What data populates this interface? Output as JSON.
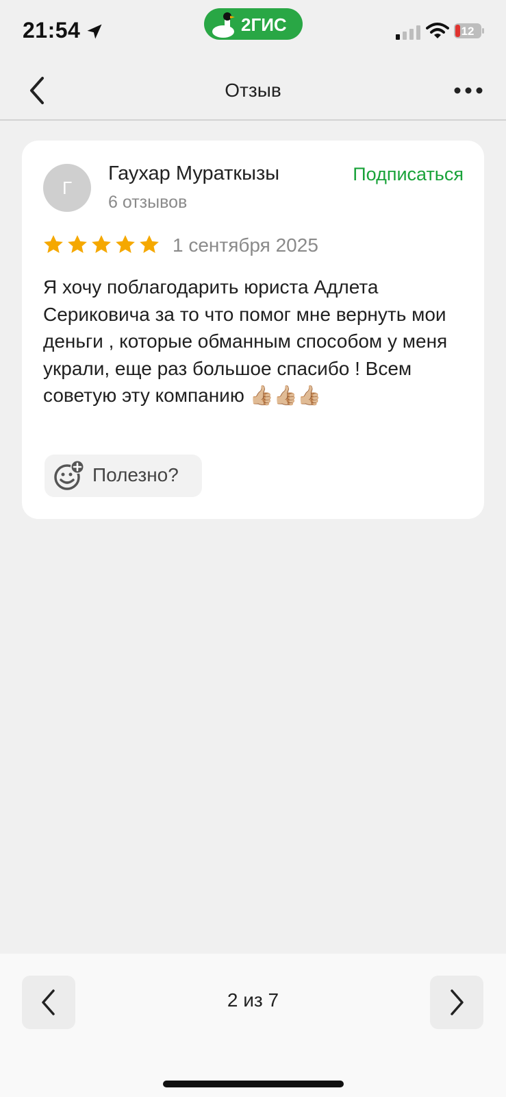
{
  "status_bar": {
    "time": "21:54",
    "battery_level": "12",
    "icons": [
      "location-arrow-icon",
      "cellular-signal-icon",
      "wifi-icon",
      "battery-icon"
    ]
  },
  "app_badge": {
    "name": "2ГИС",
    "icon": "goose-logo-icon",
    "color": "#29a745"
  },
  "nav": {
    "title": "Отзыв",
    "back_icon": "chevron-left-icon",
    "more_icon": "more-dots-icon"
  },
  "review": {
    "avatar_letter": "Г",
    "author_name": "Гаухар Мураткызы",
    "reviews_count": "6 отзывов",
    "subscribe_label": "Подписаться",
    "rating": 5,
    "rating_max": 5,
    "date": "1 сентября 2025",
    "text": "Я хочу поблагодарить юриста Адлета Сериковича за то что помог мне вернуть мои деньги , которые обманным способом у меня украли, еще раз большое спасибо ! Всем советую эту компанию 👍🏼👍🏼👍🏼",
    "useful_label": "Полезно?"
  },
  "pager": {
    "text": "2 из 7",
    "current": 2,
    "total": 7
  },
  "colors": {
    "accent_green": "#1aa33a",
    "star": "#f5a800",
    "background": "#f0f0f0",
    "card": "#ffffff"
  }
}
